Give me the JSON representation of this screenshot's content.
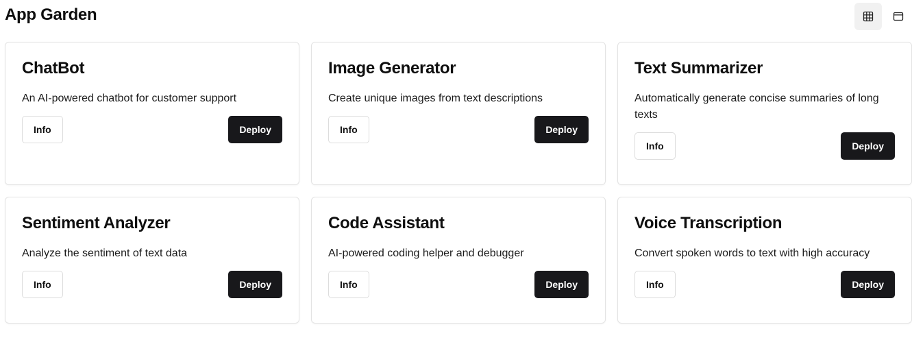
{
  "header": {
    "title": "App Garden"
  },
  "apps": [
    {
      "title": "ChatBot",
      "description": "An AI-powered chatbot for customer support",
      "info_label": "Info",
      "deploy_label": "Deploy"
    },
    {
      "title": "Image Generator",
      "description": "Create unique images from text descriptions",
      "info_label": "Info",
      "deploy_label": "Deploy"
    },
    {
      "title": "Text Summarizer",
      "description": "Automatically generate concise summaries of long texts",
      "info_label": "Info",
      "deploy_label": "Deploy"
    },
    {
      "title": "Sentiment Analyzer",
      "description": "Analyze the sentiment of text data",
      "info_label": "Info",
      "deploy_label": "Deploy"
    },
    {
      "title": "Code Assistant",
      "description": "AI-powered coding helper and debugger",
      "info_label": "Info",
      "deploy_label": "Deploy"
    },
    {
      "title": "Voice Transcription",
      "description": "Convert spoken words to text with high accuracy",
      "info_label": "Info",
      "deploy_label": "Deploy"
    }
  ],
  "icons": {
    "grid_view": "grid-icon",
    "list_view": "window-icon"
  },
  "colors": {
    "deploy_button": "#18181b",
    "active_toggle_bg": "#f1f1f1",
    "card_border": "#e3e3e3"
  }
}
